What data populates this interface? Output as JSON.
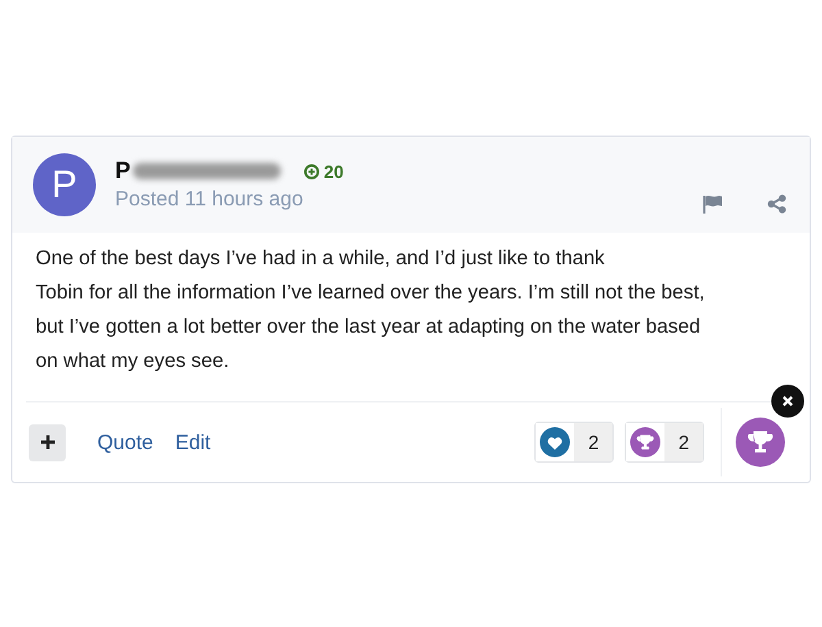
{
  "post": {
    "author_initial": "P",
    "author_name": "P",
    "points": "20",
    "posted": "Posted 11 hours ago",
    "body": "One of the best days I’ve had in a while, and I’d just like to thank\nTobin for all the information I’ve learned over the years. I’m still not the best,\nbut I’ve gotten a lot better over the last year at adapting on the water based\non what my eyes see.",
    "actions": [
      "Quote",
      "Edit"
    ],
    "reactions": [
      {
        "kind": "heart",
        "count": "2"
      },
      {
        "kind": "trophy",
        "count": "2"
      }
    ],
    "react_button": {
      "kind": "trophy"
    }
  }
}
